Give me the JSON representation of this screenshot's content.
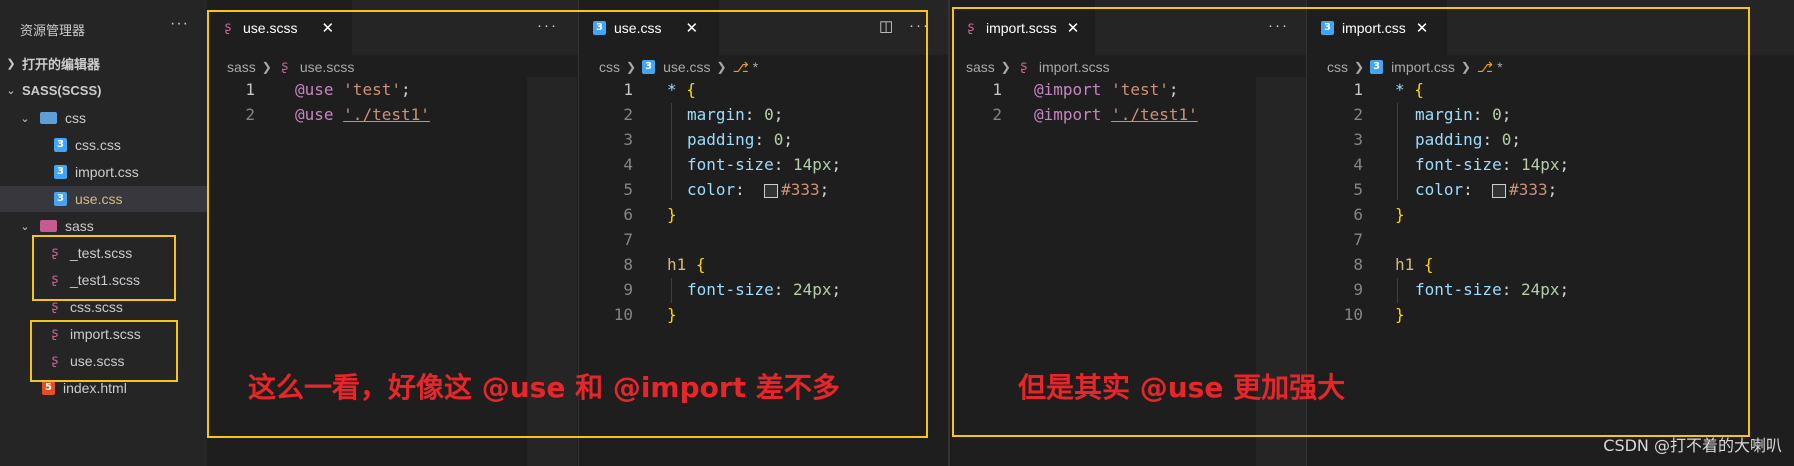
{
  "explorer": {
    "title": "资源管理器",
    "more": "···",
    "open_editors": "打开的编辑器",
    "workspace": "SASS(SCSS)",
    "items": [
      {
        "label": "css",
        "kind": "folder"
      },
      {
        "label": "css.css",
        "kind": "css"
      },
      {
        "label": "import.css",
        "kind": "css"
      },
      {
        "label": "use.css",
        "kind": "css"
      },
      {
        "label": "sass",
        "kind": "folder"
      },
      {
        "label": "_test.scss",
        "kind": "scss"
      },
      {
        "label": "_test1.scss",
        "kind": "scss"
      },
      {
        "label": "css.scss",
        "kind": "scss"
      },
      {
        "label": "import.scss",
        "kind": "scss"
      },
      {
        "label": "use.scss",
        "kind": "scss"
      },
      {
        "label": "index.html",
        "kind": "html"
      }
    ]
  },
  "pane1": {
    "tab": "use.scss",
    "bread_folder": "sass",
    "bread_file": "use.scss",
    "lines": [
      "1",
      "2"
    ]
  },
  "pane2": {
    "tab": "use.css",
    "bread_folder": "css",
    "bread_file": "use.css",
    "bread_symbol": "*"
  },
  "pane3": {
    "tab": "import.scss",
    "bread_folder": "sass",
    "bread_file": "import.scss"
  },
  "pane4": {
    "tab": "import.css",
    "bread_folder": "css",
    "bread_file": "import.css",
    "bread_symbol": "*"
  },
  "code_use_scss": {
    "kw": "@use",
    "s1": "'test'",
    "s2": "'./test1'"
  },
  "code_import_scss": {
    "kw": "@import",
    "s1": "'test'",
    "s2": "'./test1'"
  },
  "css_code": {
    "sel1": "*",
    "p_margin": "margin",
    "v_margin": "0",
    "p_padding": "padding",
    "v_padding": "0",
    "p_fs": "font-size",
    "v_fs": "14px",
    "p_color": "color",
    "v_color": "#333",
    "sel2": "h1",
    "v_fs2": "24px"
  },
  "line_numbers": [
    "1",
    "2",
    "3",
    "4",
    "5",
    "6",
    "7",
    "8",
    "9",
    "10"
  ],
  "annotations": {
    "left": "这么一看，好像这 @use 和 @import 差不多",
    "right": "但是其实 @use 更加强大"
  },
  "watermark": "CSDN @打不着的大喇叭",
  "colors": {
    "highlight_box": "#f5c518",
    "annotation": "#e8262a",
    "css_icon": "#42a5f5",
    "scss_icon": "#cd6799",
    "html_icon": "#e44d26"
  }
}
